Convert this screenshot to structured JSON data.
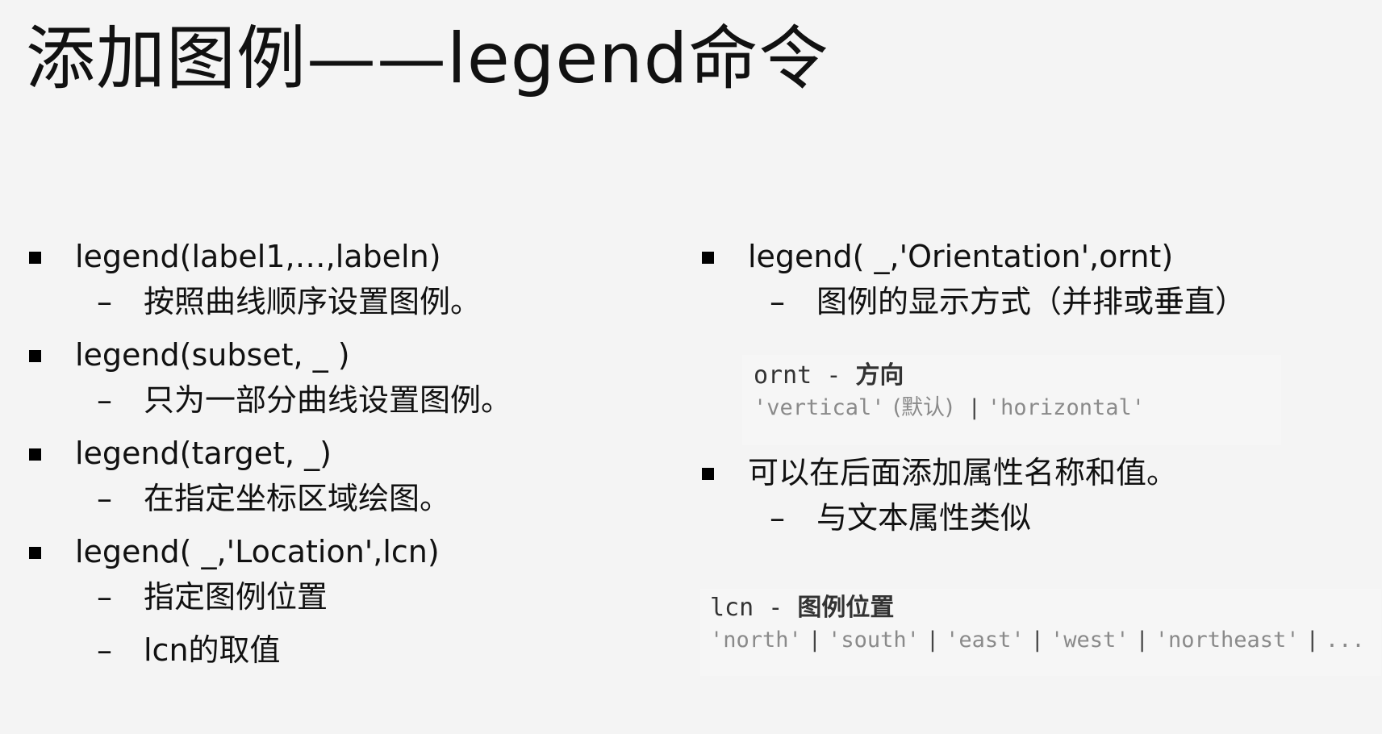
{
  "title": "添加图例——legend命令",
  "left_column": [
    {
      "bullet": "legend(label1,…,labeln)",
      "subs": [
        "按照曲线顺序设置图例。"
      ]
    },
    {
      "bullet": "legend(subset, _ )",
      "subs": [
        "只为一部分曲线设置图例。"
      ]
    },
    {
      "bullet": "legend(target, _)",
      "subs": [
        "在指定坐标区域绘图。"
      ]
    },
    {
      "bullet": "legend( _,'Location',lcn)",
      "subs": [
        "指定图例位置",
        "lcn的取值"
      ]
    }
  ],
  "right_column": {
    "bullet1": "legend( _,'Orientation',ornt)",
    "sub1": "图例的显示方式（并排或垂直）",
    "bullet2": "可以在后面添加属性名称和值。",
    "sub2": "与文本属性类似"
  },
  "ornt_box": {
    "name": "ornt",
    "desc": "方向",
    "v1": "'vertical'",
    "default_note": "(默认)",
    "v2": "'horizontal'"
  },
  "lcn_box": {
    "name": "lcn",
    "desc": "图例位置",
    "values": [
      "'north'",
      "'south'",
      "'east'",
      "'west'",
      "'northeast'"
    ],
    "ellipsis": "..."
  }
}
